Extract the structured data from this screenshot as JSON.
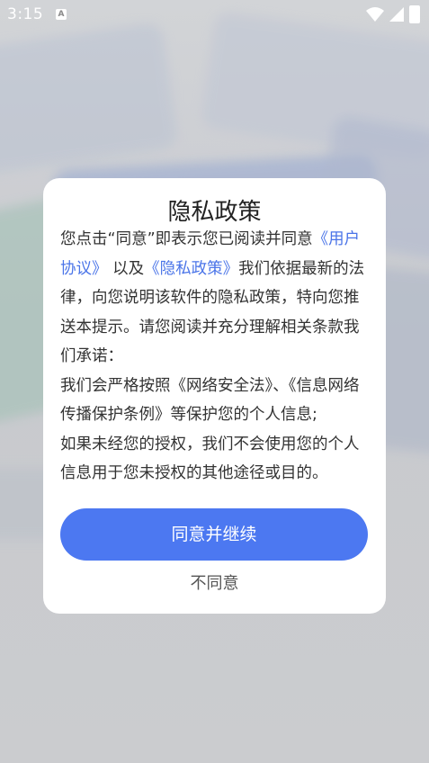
{
  "status_bar": {
    "time": "3:15",
    "sim_badge": "A"
  },
  "dialog": {
    "title": "隐私政策",
    "para1_before": "您点击“同意”即表示您已阅读并同意",
    "link_user_agreement": "《用户协议》",
    "para1_mid": "以及",
    "link_privacy_policy": "《隐私政策》",
    "para1_after": "我们依据最新的法律，向您说明该软件的隐私政策，特向您推送本提示。请您阅读并充分理解相关条款我们承诺：",
    "para2": "我们会严格按照《网络安全法》、《信息网络传播保护条例》等保护您的个人信息;",
    "para3": "如果未经您的授权，我们不会使用您的个人信息用于您未授权的其他途径或目的。",
    "agree_button": "同意并继续",
    "disagree_button": "不同意"
  },
  "colors": {
    "accent": "#4c78f1",
    "link": "#4a74e8"
  }
}
